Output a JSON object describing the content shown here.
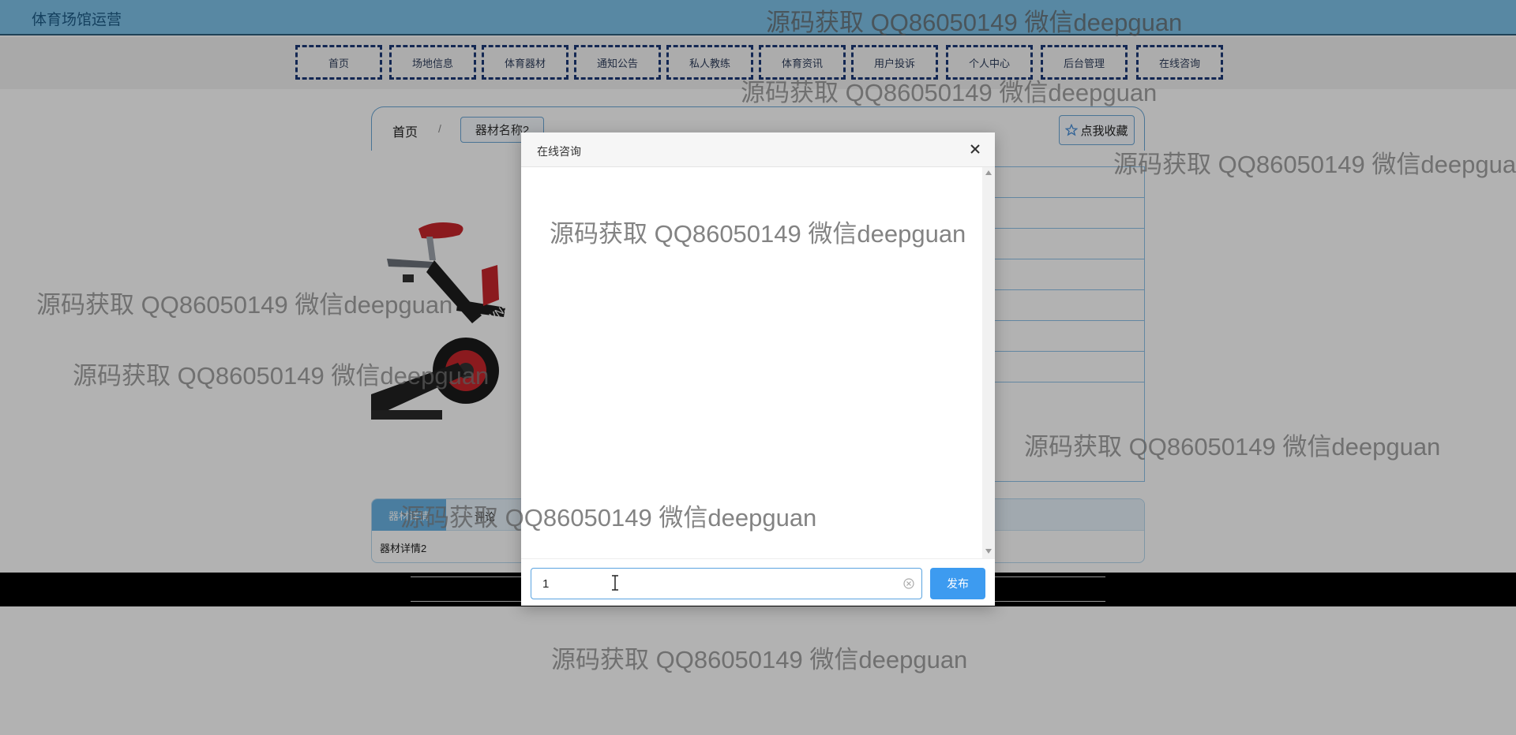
{
  "app": {
    "site_title": "体育场馆运营",
    "watermark": "源码获取 QQ86050149 微信deepguan"
  },
  "nav": {
    "items": [
      {
        "label": "首页"
      },
      {
        "label": "场地信息"
      },
      {
        "label": "体育器材"
      },
      {
        "label": "通知公告"
      },
      {
        "label": "私人教练"
      },
      {
        "label": "体育资讯"
      },
      {
        "label": "用户投诉"
      },
      {
        "label": "个人中心"
      },
      {
        "label": "后台管理"
      },
      {
        "label": "在线咨询"
      }
    ]
  },
  "breadcrumb": {
    "home": "首页",
    "separator": "/",
    "current": "器材名称2"
  },
  "favorite": {
    "label": "点我收藏",
    "icon": "star-icon"
  },
  "detail": {
    "tab_active": "器材详情",
    "tab_second": "评论",
    "text": "器材详情2"
  },
  "dialog": {
    "title": "在线咨询",
    "input_value": "1",
    "send_label": "发布",
    "close_icon": "close-icon",
    "clear_icon": "clear-icon"
  },
  "colors": {
    "topbar": "#7ec3ea",
    "nav_border": "#1e3a78",
    "send_button": "#3d9bf0",
    "accent_border": "#6aa7d6"
  }
}
